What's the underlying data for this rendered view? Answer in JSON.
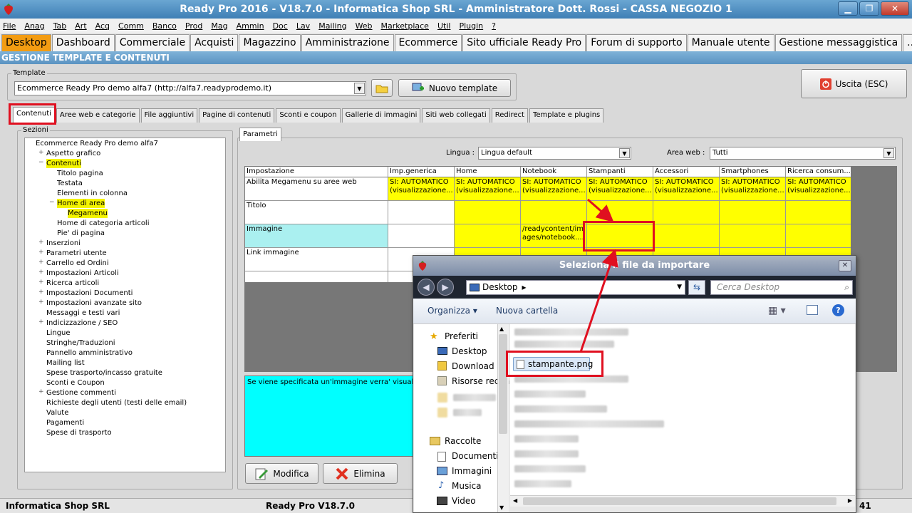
{
  "window": {
    "title": "Ready Pro 2016 - V18.7.0 - Informatica Shop SRL - Amministratore Dott. Rossi - CASSA NEGOZIO 1"
  },
  "menu": [
    "File",
    "Anag",
    "Tab",
    "Art",
    "Acq",
    "Comm",
    "Banco",
    "Prod",
    "Mag",
    "Ammin",
    "Doc",
    "Lav",
    "Mailing",
    "Web",
    "Marketplace",
    "Util",
    "Plugin",
    "?"
  ],
  "main_tabs": [
    "Desktop",
    "Dashboard",
    "Commerciale",
    "Acquisti",
    "Magazzino",
    "Amministrazione",
    "Ecommerce",
    "Sito ufficiale Ready Pro",
    "Forum di supporto",
    "Manuale utente",
    "Gestione messaggistica",
    "..."
  ],
  "section_header": "GESTIONE TEMPLATE E CONTENUTI",
  "template": {
    "label": "Template",
    "value": "Ecommerce Ready Pro demo alfa7 (http://alfa7.readyprodemo.it)",
    "new_button": "Nuovo template"
  },
  "exit_button": "Uscita (ESC)",
  "sub_tabs": [
    "Contenuti",
    "Aree web e categorie",
    "File aggiuntivi",
    "Pagine di contenuti",
    "Sconti e coupon",
    "Gallerie di immagini",
    "Siti web collegati",
    "Redirect",
    "Template e plugins"
  ],
  "sections": {
    "label": "Sezioni",
    "root": "Ecommerce Ready Pro demo alfa7",
    "items": [
      {
        "label": "Aspetto grafico",
        "level": 1,
        "exp": "+"
      },
      {
        "label": "Contenuti",
        "level": 1,
        "exp": "−",
        "hl": true
      },
      {
        "label": "Titolo pagina",
        "level": 2
      },
      {
        "label": "Testata",
        "level": 2
      },
      {
        "label": "Elementi in colonna",
        "level": 2
      },
      {
        "label": "Home di area",
        "level": 2,
        "exp": "−",
        "hl": true
      },
      {
        "label": "Megamenu",
        "level": 3,
        "hl": true
      },
      {
        "label": "Home di categoria articoli",
        "level": 2
      },
      {
        "label": "Pie' di pagina",
        "level": 2
      },
      {
        "label": "Inserzioni",
        "level": 1,
        "exp": "+"
      },
      {
        "label": "Parametri utente",
        "level": 1,
        "exp": "+"
      },
      {
        "label": "Carrello ed Ordini",
        "level": 1,
        "exp": "+"
      },
      {
        "label": "Impostazioni Articoli",
        "level": 1,
        "exp": "+"
      },
      {
        "label": "Ricerca articoli",
        "level": 1,
        "exp": "+"
      },
      {
        "label": "Impostazioni Documenti",
        "level": 1,
        "exp": "+"
      },
      {
        "label": "Impostazioni avanzate sito",
        "level": 1,
        "exp": "+"
      },
      {
        "label": "Messaggi e testi vari",
        "level": 1
      },
      {
        "label": "Indicizzazione / SEO",
        "level": 1,
        "exp": "+"
      },
      {
        "label": "Lingue",
        "level": 1
      },
      {
        "label": "Stringhe/Traduzioni",
        "level": 1
      },
      {
        "label": "Pannello amministrativo",
        "level": 1
      },
      {
        "label": "Mailing list",
        "level": 1
      },
      {
        "label": "Spese trasporto/incasso gratuite",
        "level": 1
      },
      {
        "label": "Sconti e Coupon",
        "level": 1
      },
      {
        "label": "Gestione commenti",
        "level": 1,
        "exp": "+"
      },
      {
        "label": "Richieste degli utenti (testi delle email)",
        "level": 1
      },
      {
        "label": "Valute",
        "level": 1
      },
      {
        "label": "Pagamenti",
        "level": 1
      },
      {
        "label": "Spese di trasporto",
        "level": 1
      }
    ]
  },
  "params": {
    "tab": "Parametri",
    "lingua_label": "Lingua :",
    "lingua_value": "Lingua default",
    "area_label": "Area web :",
    "area_value": "Tutti",
    "columns": [
      "Impostazione",
      "Imp.generica",
      "Home",
      "Notebook",
      "Stampanti",
      "Accessori",
      "Smartphones",
      "Ricerca consum..."
    ],
    "rows": [
      {
        "name": "Abilita Megamenu su aree web",
        "cells": [
          "SI: AUTOMATICO\n(visualizzazione...",
          "SI: AUTOMATICO\n(visualizzazione...",
          "SI: AUTOMATICO\n(visualizzazione...",
          "SI: AUTOMATICO\n(visualizzazione...",
          "SI: AUTOMATICO\n(visualizzazione...",
          "SI: AUTOMATICO\n(visualizzazione...",
          "SI: AUTOMATICO\n(visualizzazione..."
        ]
      },
      {
        "name": "Titolo",
        "cells": [
          "",
          "",
          "",
          "",
          "",
          "",
          ""
        ]
      },
      {
        "name": "Immagine",
        "cells": [
          "",
          "",
          "/readycontent/im\nages/notebook....",
          "",
          "",
          "",
          ""
        ]
      },
      {
        "name": "Link immagine",
        "cells": [
          "",
          "",
          "",
          "",
          "",
          "",
          ""
        ]
      }
    ],
    "description": "Se viene specificata un'immagine verra' visualizzata a"
  },
  "actions": {
    "modify": "Modifica",
    "delete": "Elimina"
  },
  "status": {
    "company": "Informatica Shop SRL",
    "version": "Ready Pro V18.7.0",
    "right": "41"
  },
  "dialog": {
    "title": "Seleziona il file da importare",
    "path": "Desktop",
    "search_placeholder": "Cerca Desktop",
    "organize": "Organizza",
    "new_folder": "Nuova cartella",
    "nav": {
      "favorites": "Preferiti",
      "fav_items": [
        "Desktop",
        "Download",
        "Risorse recen"
      ],
      "libraries": "Raccolte",
      "lib_items": [
        "Documenti",
        "Immagini",
        "Musica",
        "Video"
      ]
    },
    "selected_file": "stampante.png"
  },
  "colors": {
    "accent_tab": "#f39c12",
    "highlight": "#ffff00",
    "callout": "#e01020"
  }
}
